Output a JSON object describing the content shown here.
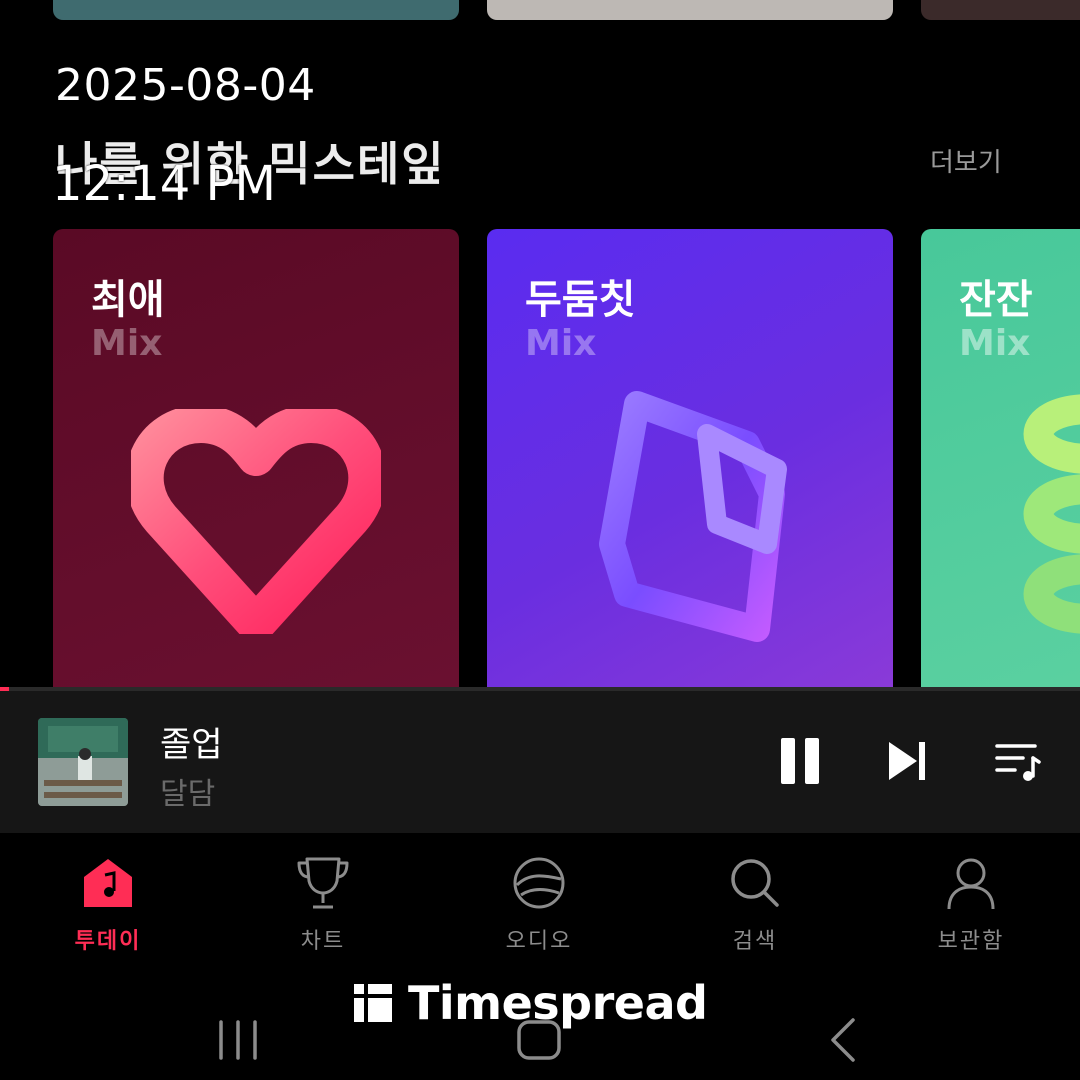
{
  "overlay": {
    "date": "2025-08-04",
    "time": "12:14 PM",
    "watermark": "Timespread"
  },
  "section": {
    "title": "나를 위한 믹스테잎",
    "more_label": "더보기"
  },
  "mixes": [
    {
      "name": "최애",
      "sub": "Mix"
    },
    {
      "name": "두둠칫",
      "sub": "Mix"
    },
    {
      "name": "잔잔",
      "sub": "Mix"
    }
  ],
  "player": {
    "title": "졸업",
    "artist": "달담",
    "progress": 0.008
  },
  "bottom_nav": {
    "items": [
      {
        "label": "투데이",
        "icon": "home-music-icon",
        "active": true
      },
      {
        "label": "차트",
        "icon": "trophy-icon",
        "active": false
      },
      {
        "label": "오디오",
        "icon": "audio-globe-icon",
        "active": false
      },
      {
        "label": "검색",
        "icon": "search-icon",
        "active": false
      },
      {
        "label": "보관함",
        "icon": "person-icon",
        "active": false
      }
    ]
  },
  "colors": {
    "accent": "#ff2d55",
    "background": "#000000",
    "player_bg": "#161616"
  }
}
